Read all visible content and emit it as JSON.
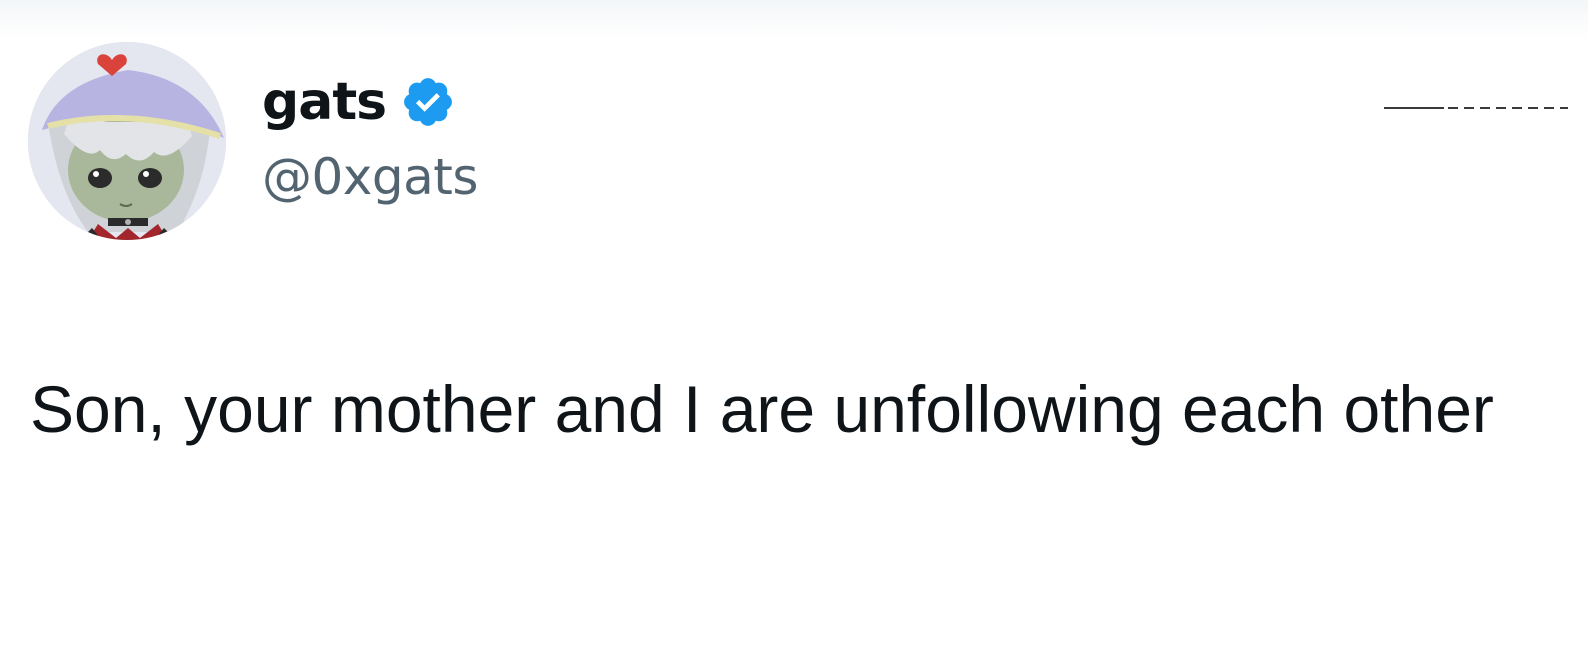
{
  "tweet": {
    "author": {
      "display_name": "gats",
      "handle": "@0xgats",
      "verified": true,
      "verified_icon": "verified-badge-icon",
      "avatar": "anime-character-avatar"
    },
    "text": "Son, your mother and I are unfollowing each other"
  },
  "colors": {
    "text_primary": "#0f1419",
    "text_secondary": "#536471",
    "verified_blue": "#1d9bf0",
    "background": "#ffffff"
  }
}
